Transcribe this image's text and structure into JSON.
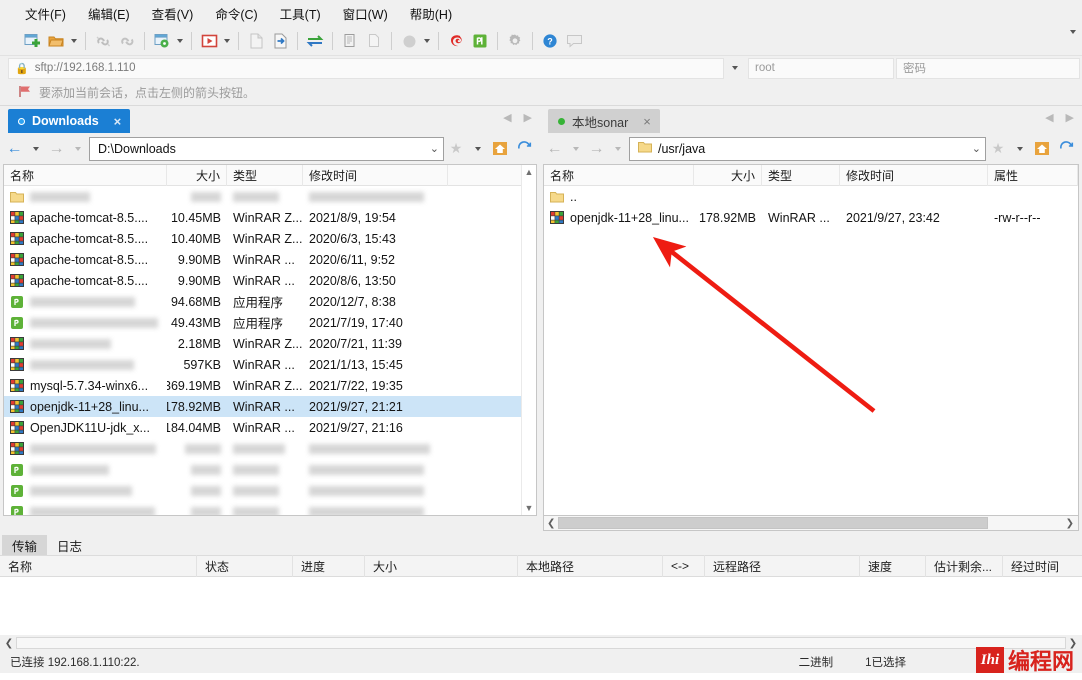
{
  "menu": {
    "items": [
      {
        "label": "文件(F)",
        "name": "menu-file"
      },
      {
        "label": "编辑(E)",
        "name": "menu-edit"
      },
      {
        "label": "查看(V)",
        "name": "menu-view"
      },
      {
        "label": "命令(C)",
        "name": "menu-command"
      },
      {
        "label": "工具(T)",
        "name": "menu-tools"
      },
      {
        "label": "窗口(W)",
        "name": "menu-window"
      },
      {
        "label": "帮助(H)",
        "name": "menu-help"
      }
    ]
  },
  "connection": {
    "url": "sftp://192.168.1.110",
    "username": "root",
    "password_placeholder": "密码",
    "hint": "要添加当前会话，点击左侧的箭头按钮。"
  },
  "left_panel": {
    "tab": {
      "label": "Downloads",
      "close": "×"
    },
    "path": "D:\\Downloads",
    "columns": [
      "名称",
      "大小",
      "类型",
      "修改时间"
    ],
    "rows": [
      {
        "name": "",
        "size": "",
        "type": "",
        "mtime": "",
        "icon": "folder-icon",
        "blurred": true
      },
      {
        "name": "apache-tomcat-8.5....",
        "size": "10.45MB",
        "type": "WinRAR Z...",
        "mtime": "2021/8/9, 19:54",
        "icon": "winrar-icon",
        "blurred": false
      },
      {
        "name": "apache-tomcat-8.5....",
        "size": "10.40MB",
        "type": "WinRAR Z...",
        "mtime": "2020/6/3, 15:43",
        "icon": "winrar-icon",
        "blurred": false
      },
      {
        "name": "apache-tomcat-8.5....",
        "size": "9.90MB",
        "type": "WinRAR ...",
        "mtime": "2020/6/11, 9:52",
        "icon": "winrar-icon",
        "blurred": false
      },
      {
        "name": "apache-tomcat-8.5....",
        "size": "9.90MB",
        "type": "WinRAR ...",
        "mtime": "2020/8/6, 13:50",
        "icon": "winrar-icon",
        "blurred": false
      },
      {
        "name": "Fiddler Everywhere ...",
        "size": "94.68MB",
        "type": "应用程序",
        "mtime": "2020/12/7, 8:38",
        "icon": "app-icon",
        "blurred": true
      },
      {
        "name": "",
        "size": "49.43MB",
        "type": "应用程序",
        "mtime": "2021/7/19, 17:40",
        "icon": "app-icon",
        "blurred": true
      },
      {
        "name": "",
        "size": "2.18MB",
        "type": "WinRAR Z...",
        "mtime": "2020/7/21, 11:39",
        "icon": "winrar-icon",
        "blurred": true
      },
      {
        "name": "",
        "size": "597KB",
        "type": "WinRAR ...",
        "mtime": "2021/1/13, 15:45",
        "icon": "winrar-icon",
        "blurred": true
      },
      {
        "name": "mysql-5.7.34-winx6...",
        "size": "369.19MB",
        "type": "WinRAR Z...",
        "mtime": "2021/7/22, 19:35",
        "icon": "winrar-icon",
        "blurred": false
      },
      {
        "name": "openjdk-11+28_linu...",
        "size": "178.92MB",
        "type": "WinRAR ...",
        "mtime": "2021/9/27, 21:21",
        "icon": "winrar-icon",
        "blurred": false,
        "selected": true
      },
      {
        "name": "OpenJDK11U-jdk_x...",
        "size": "184.04MB",
        "type": "WinRAR ...",
        "mtime": "2021/9/27, 21:16",
        "icon": "winrar-icon",
        "blurred": false
      },
      {
        "name": "",
        "size": "2.08MB",
        "type": "WinRAR",
        "mtime": "2021/3/18  13:58",
        "icon": "winrar-icon",
        "blurred": true
      },
      {
        "name": "",
        "size": "",
        "type": "",
        "mtime": "",
        "icon": "app-icon",
        "blurred": true
      },
      {
        "name": "",
        "size": "",
        "type": "",
        "mtime": "",
        "icon": "app-icon",
        "blurred": true
      },
      {
        "name": "",
        "size": "",
        "type": "",
        "mtime": "",
        "icon": "app-icon",
        "blurred": true
      }
    ]
  },
  "right_panel": {
    "tab": {
      "label": "本地sonar",
      "close": "×"
    },
    "path": "/usr/java",
    "columns": [
      "名称",
      "大小",
      "类型",
      "修改时间",
      "属性"
    ],
    "rows": [
      {
        "name": "..",
        "size": "",
        "type": "",
        "mtime": "",
        "attr": "",
        "icon": "folder-icon"
      },
      {
        "name": "openjdk-11+28_linu...",
        "size": "178.92MB",
        "type": "WinRAR ...",
        "mtime": "2021/9/27, 23:42",
        "attr": "-rw-r--r--",
        "icon": "winrar-icon"
      }
    ]
  },
  "transfer": {
    "tabs": [
      {
        "label": "传输",
        "active": true
      },
      {
        "label": "日志",
        "active": false
      }
    ],
    "columns": [
      "名称",
      "状态",
      "进度",
      "大小",
      "本地路径",
      "<->",
      "远程路径",
      "速度",
      "估计剩余...",
      "经过时间"
    ]
  },
  "status": {
    "connected": "已连接 192.168.1.110:22.",
    "mode": "二进制",
    "selection": "1已选择"
  },
  "watermark": {
    "badge": "Ihi",
    "text": "编程网"
  },
  "toolbar": {
    "icons": [
      {
        "name": "new-session-icon",
        "caret": false
      },
      {
        "name": "open-folder-icon",
        "caret": true
      },
      {
        "name": "sep",
        "caret": false
      },
      {
        "name": "link-broken-icon",
        "caret": false
      },
      {
        "name": "link-icon",
        "caret": false
      },
      {
        "name": "sep",
        "caret": false
      },
      {
        "name": "session-settings-icon",
        "caret": true
      },
      {
        "name": "sep",
        "caret": false
      },
      {
        "name": "run-script-icon",
        "caret": true
      },
      {
        "name": "sep",
        "caret": false
      },
      {
        "name": "new-file-icon",
        "caret": false
      },
      {
        "name": "transfer-file-icon",
        "caret": false
      },
      {
        "name": "sep",
        "caret": false
      },
      {
        "name": "sync-browsing-icon",
        "caret": false
      },
      {
        "name": "sep",
        "caret": false
      },
      {
        "name": "copy-icon",
        "caret": false
      },
      {
        "name": "paste-icon",
        "caret": false
      },
      {
        "name": "sep",
        "caret": false
      },
      {
        "name": "globe-icon",
        "caret": true
      },
      {
        "name": "sep",
        "caret": false
      },
      {
        "name": "winscp-icon",
        "caret": false
      },
      {
        "name": "putty-icon",
        "caret": false
      },
      {
        "name": "sep",
        "caret": false
      },
      {
        "name": "preferences-gear-icon",
        "caret": false
      },
      {
        "name": "sep",
        "caret": false
      },
      {
        "name": "help-icon",
        "caret": false
      },
      {
        "name": "feedback-icon",
        "caret": false
      }
    ],
    "overflow": "chevron-down-icon"
  },
  "colors": {
    "accent": "#1b7fd4",
    "selection": "#cce4f7",
    "chrome": "#f0f0f0",
    "annotation": "#ee1c12",
    "watermark": "#d8231d"
  }
}
